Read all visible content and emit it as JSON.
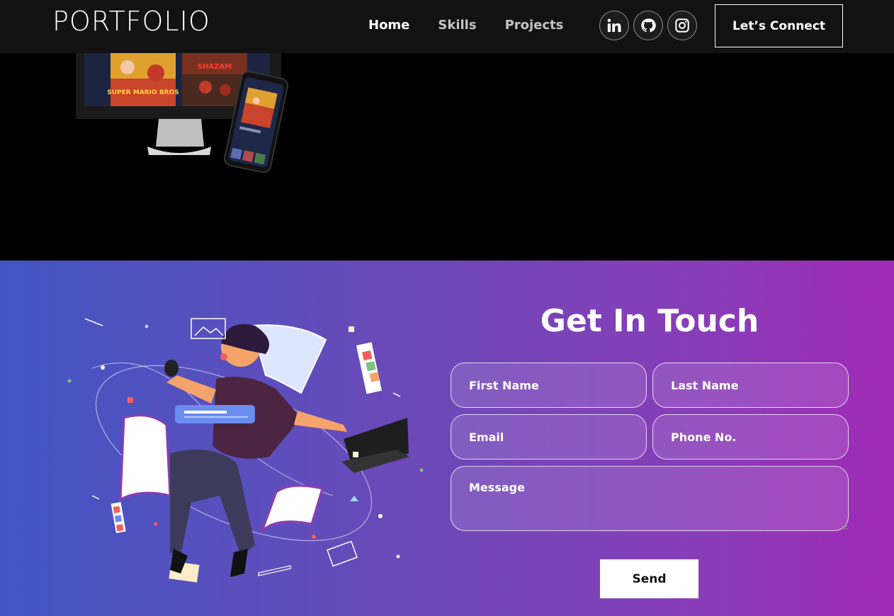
{
  "navbar": {
    "logo": "PORTFOLIO",
    "links": [
      "Home",
      "Skills",
      "Projects"
    ],
    "socials": [
      "linkedin-icon",
      "github-icon",
      "instagram-icon"
    ],
    "connect_label": "Let’s Connect"
  },
  "project_preview": {
    "monitor_posters": [
      "SUPER MARIO BROS",
      "SHAZAM"
    ]
  },
  "contact": {
    "title": "Get In Touch",
    "first_name_placeholder": "First Name",
    "last_name_placeholder": "Last Name",
    "email_placeholder": "Email",
    "phone_placeholder": "Phone No.",
    "message_placeholder": "Message",
    "send_label": "Send"
  },
  "colors": {
    "navbar_bg": "#121212",
    "gradient_start": "#4156c4",
    "gradient_end": "#a12ab6"
  }
}
